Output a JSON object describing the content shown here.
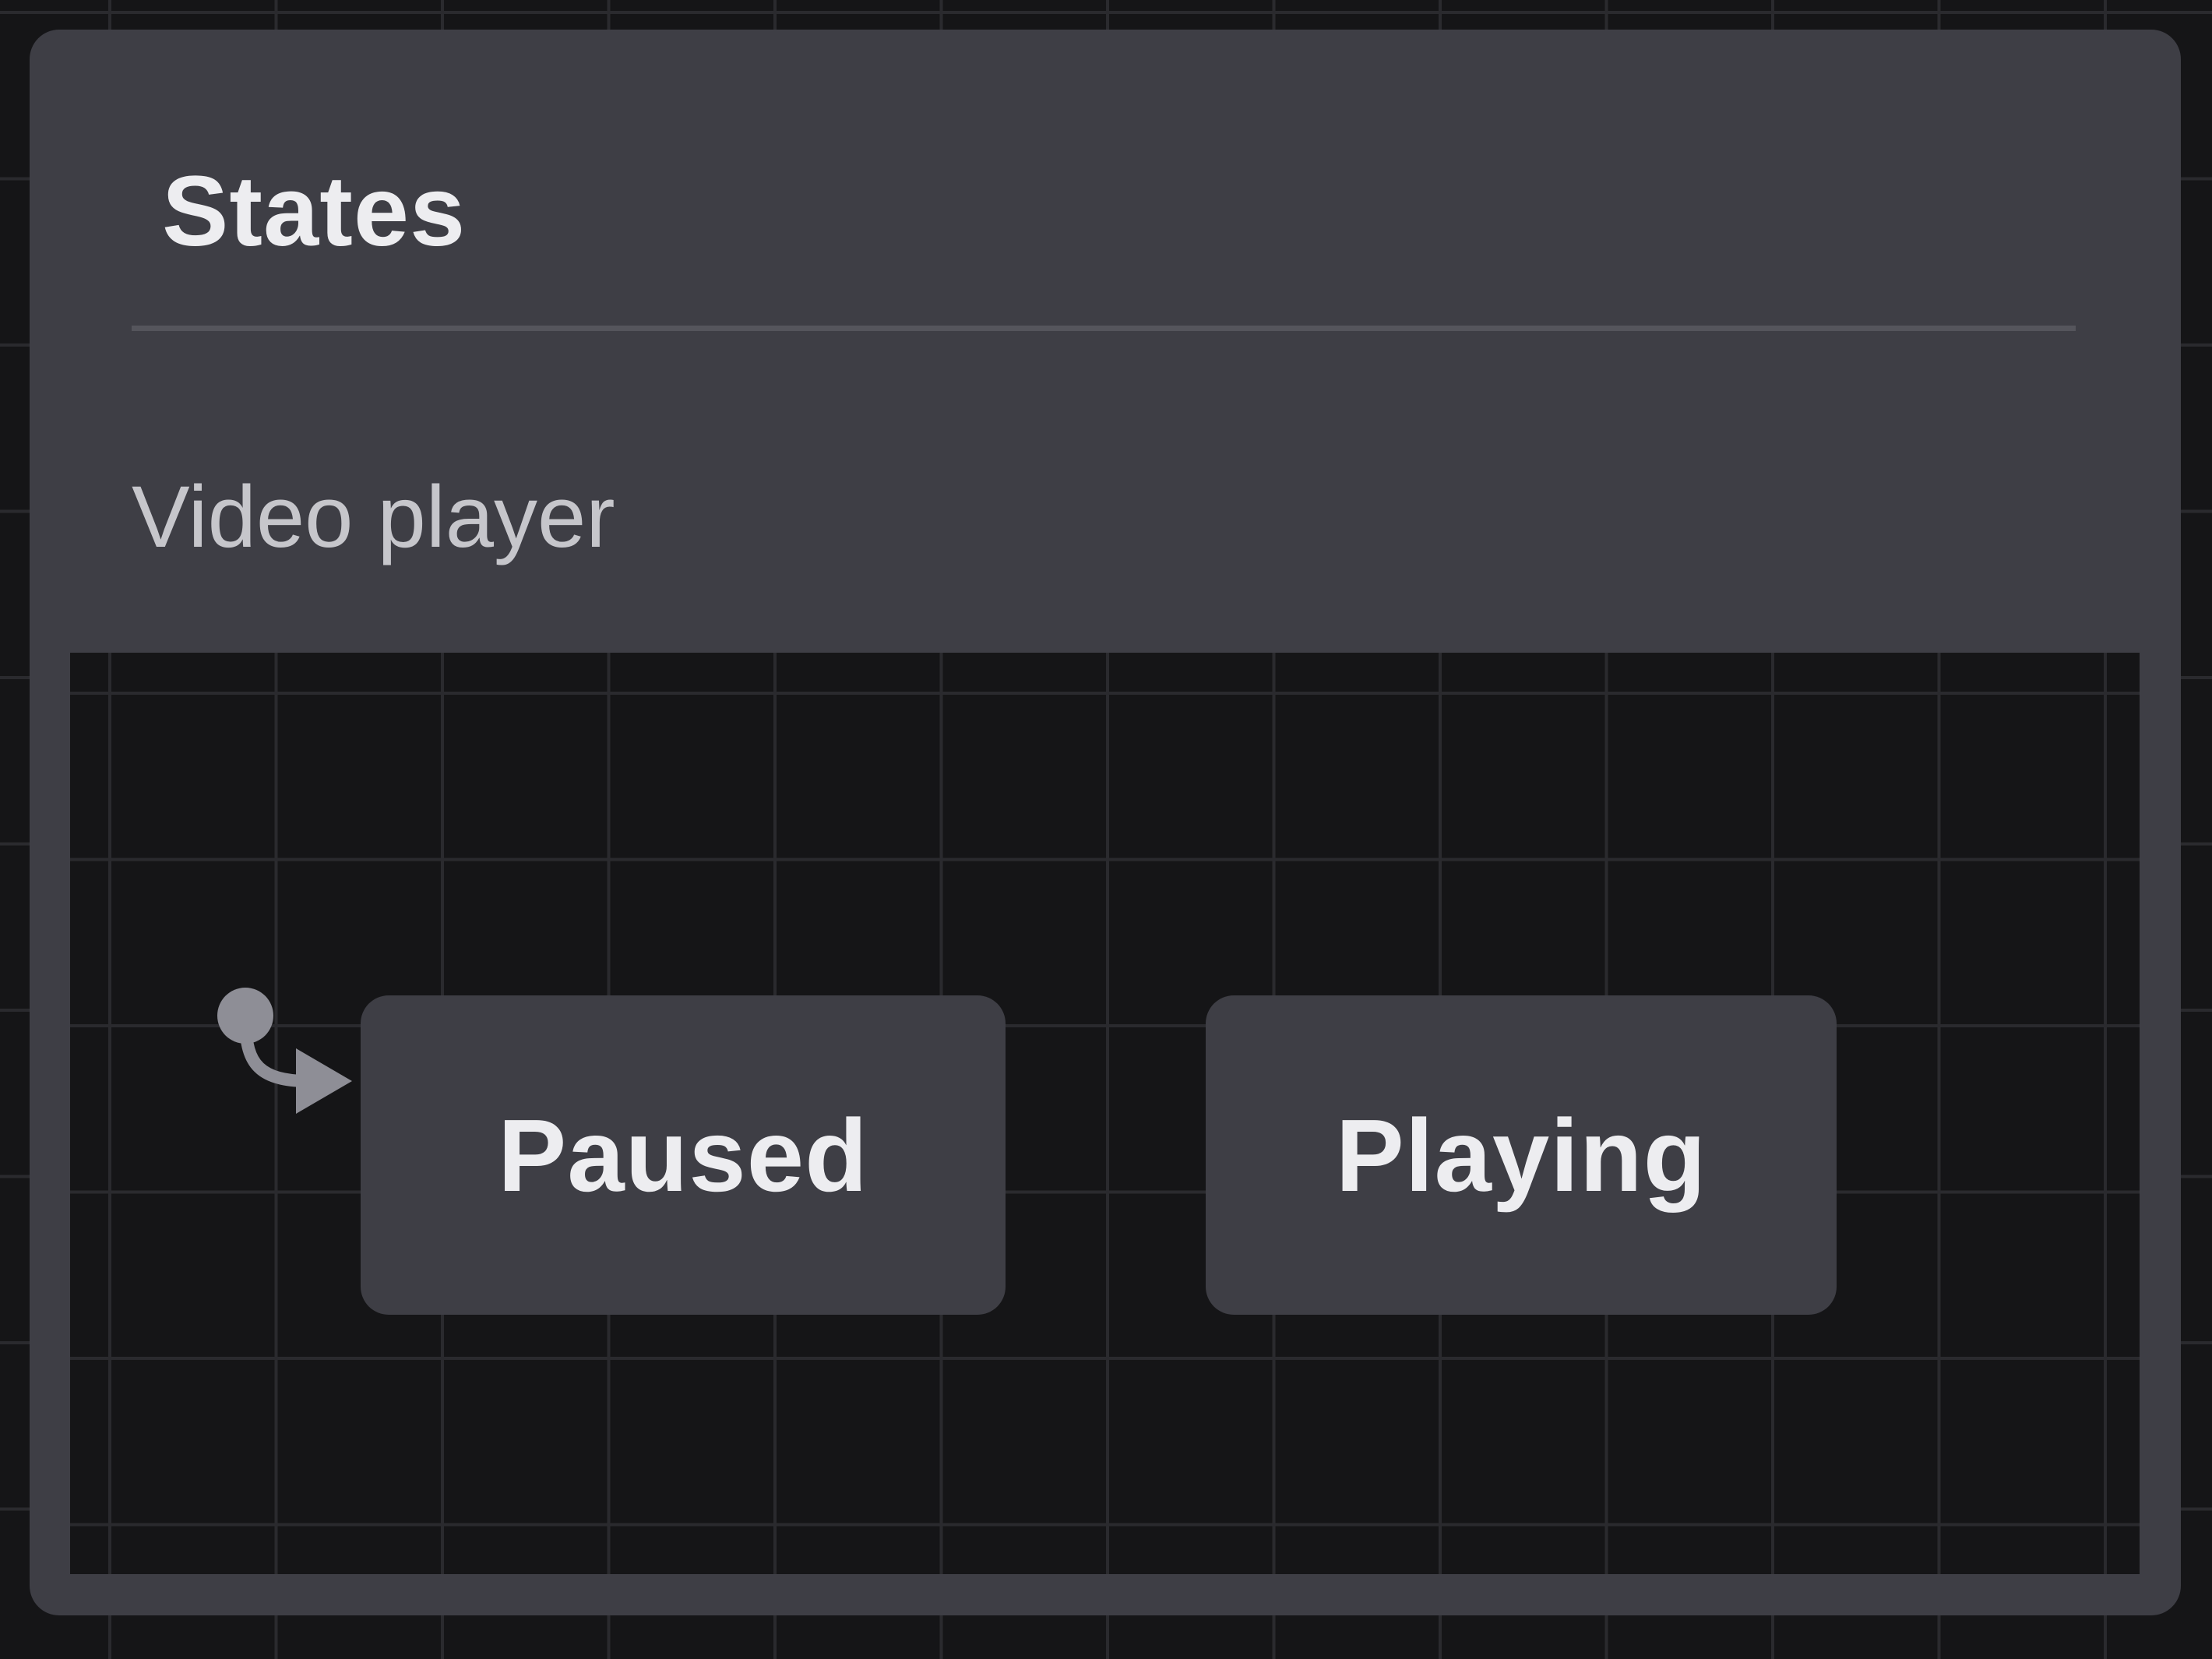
{
  "panel": {
    "title": "States",
    "subtitle": "Video player"
  },
  "states": [
    {
      "label": "Paused",
      "initial": true
    },
    {
      "label": "Playing",
      "initial": false
    }
  ],
  "colors": {
    "background": "#151517",
    "panel": "#3e3e45",
    "text": "#ededf0",
    "subtitle": "#c6c6cb",
    "initial_marker": "#8e8e96"
  }
}
